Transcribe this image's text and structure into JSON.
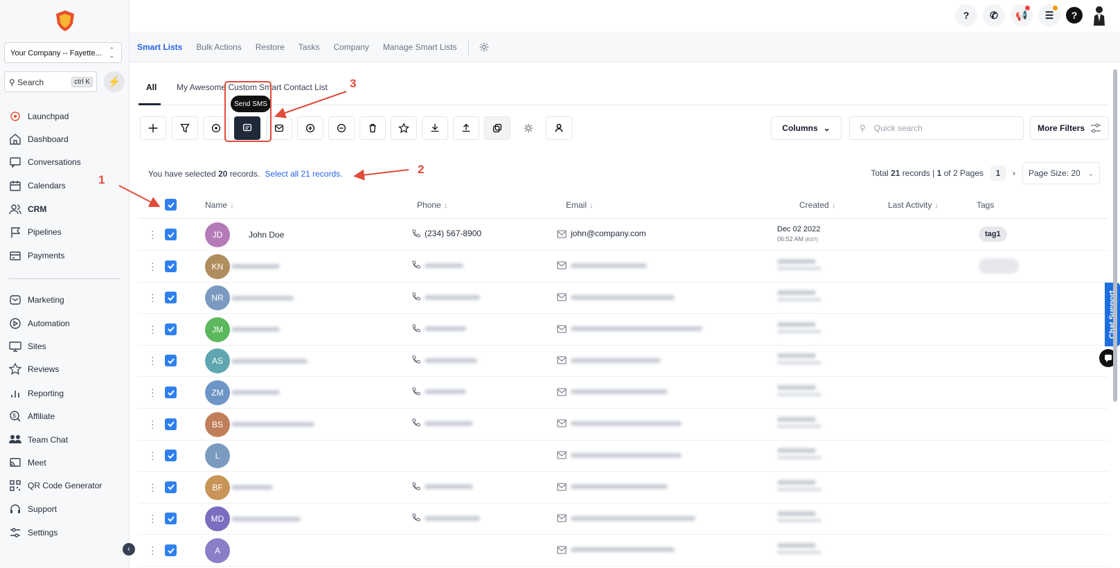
{
  "app": {
    "company_selector": "Your Company -- Fayette...",
    "search_label": "Search",
    "search_shortcut": "ctrl K"
  },
  "sidebar": {
    "items": [
      {
        "label": "Launchpad",
        "icon": "launchpad-icon"
      },
      {
        "label": "Dashboard",
        "icon": "home-icon"
      },
      {
        "label": "Conversations",
        "icon": "chat-icon"
      },
      {
        "label": "Calendars",
        "icon": "calendar-icon"
      },
      {
        "label": "CRM",
        "icon": "users-icon"
      },
      {
        "label": "Pipelines",
        "icon": "flag-icon"
      },
      {
        "label": "Payments",
        "icon": "payments-icon"
      },
      {
        "label": "Marketing",
        "icon": "mail-icon"
      },
      {
        "label": "Automation",
        "icon": "play-circle-icon"
      },
      {
        "label": "Sites",
        "icon": "monitor-icon"
      },
      {
        "label": "Reviews",
        "icon": "star-icon"
      },
      {
        "label": "Reporting",
        "icon": "bar-chart-icon"
      },
      {
        "label": "Affiliate",
        "icon": "dollar-search-icon"
      },
      {
        "label": "Team Chat",
        "icon": "team-icon"
      },
      {
        "label": "Meet",
        "icon": "cast-icon"
      },
      {
        "label": "QR Code Generator",
        "icon": "qr-icon"
      },
      {
        "label": "Support",
        "icon": "headset-icon"
      }
    ],
    "settings_label": "Settings"
  },
  "subtabs": [
    "Smart Lists",
    "Bulk Actions",
    "Restore",
    "Tasks",
    "Company",
    "Manage Smart Lists"
  ],
  "listtabs": {
    "all": "All",
    "custom": "My Awesome Custom Smart Contact List"
  },
  "toolbar": {
    "tooltip": "Send SMS",
    "columns_label": "Columns",
    "quick_search_placeholder": "Quick search",
    "more_filters_label": "More Filters"
  },
  "selection": {
    "prefix": "You have selected",
    "count": "20",
    "suffix": "records.",
    "select_all": "Select all 21 records.",
    "total_prefix": "Total",
    "total": "21",
    "records_word": "records |",
    "page_current": "1",
    "of_pages": "of 2 Pages",
    "page_number": "1",
    "page_size": "Page Size: 20"
  },
  "table": {
    "columns": [
      "Name",
      "Phone",
      "Email",
      "Created",
      "Last Activity",
      "Tags"
    ],
    "rows": [
      {
        "initials": "JD",
        "color": "#b57bb8",
        "name": "John Doe",
        "phone": "(234) 567-8900",
        "email": "john@company.com",
        "created_date": "Dec 02 2022",
        "created_time": "06:52 AM",
        "created_tz": "(EST)",
        "tag": "tag1"
      },
      {
        "initials": "KN",
        "color": "#b08d5e"
      },
      {
        "initials": "NR",
        "color": "#7b9ac0"
      },
      {
        "initials": "JM",
        "color": "#5cb85c"
      },
      {
        "initials": "AS",
        "color": "#5fa7b0"
      },
      {
        "initials": "ZM",
        "color": "#6d96c6"
      },
      {
        "initials": "BS",
        "color": "#c07e5a"
      },
      {
        "initials": "L",
        "color": "#7b9ac0"
      },
      {
        "initials": "BF",
        "color": "#c89458"
      },
      {
        "initials": "MD",
        "color": "#7d6dc0"
      },
      {
        "initials": "A",
        "color": "#8b7dc6"
      }
    ]
  },
  "annotations": {
    "one": "1",
    "two": "2",
    "three": "3"
  },
  "chat_support": "Chat Support"
}
